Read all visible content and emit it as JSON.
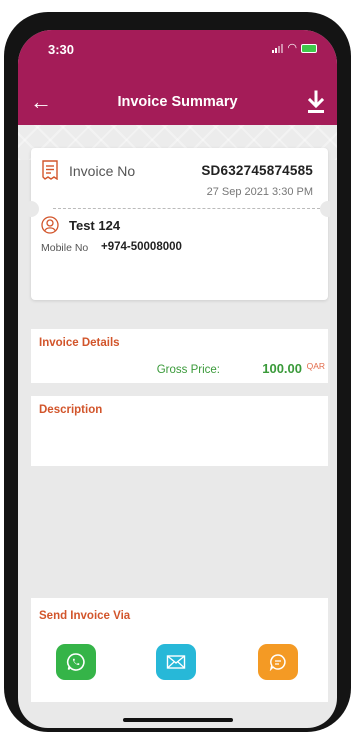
{
  "status_bar": {
    "time": "3:30"
  },
  "header": {
    "title": "Invoice Summary"
  },
  "invoice": {
    "number_label": "Invoice No",
    "number": "SD632745874585",
    "date": "27 Sep 2021 3:30 PM",
    "customer_name": "Test 124",
    "mobile_label": "Mobile No",
    "mobile": "+974-50008000"
  },
  "details": {
    "title": "Invoice Details",
    "gross_label": "Gross Price:",
    "gross_value": "100.00",
    "currency": "QAR"
  },
  "description": {
    "title": "Description"
  },
  "send": {
    "title": "Send Invoice Via",
    "channels": [
      "whatsapp-icon",
      "mail-icon",
      "sms-chat-icon"
    ]
  },
  "colors": {
    "primary": "#a41c58",
    "section_title": "#d2552b",
    "price": "#3a9a3a",
    "whatsapp": "#35b448",
    "mail": "#27b8d8",
    "sms": "#f49a24"
  }
}
